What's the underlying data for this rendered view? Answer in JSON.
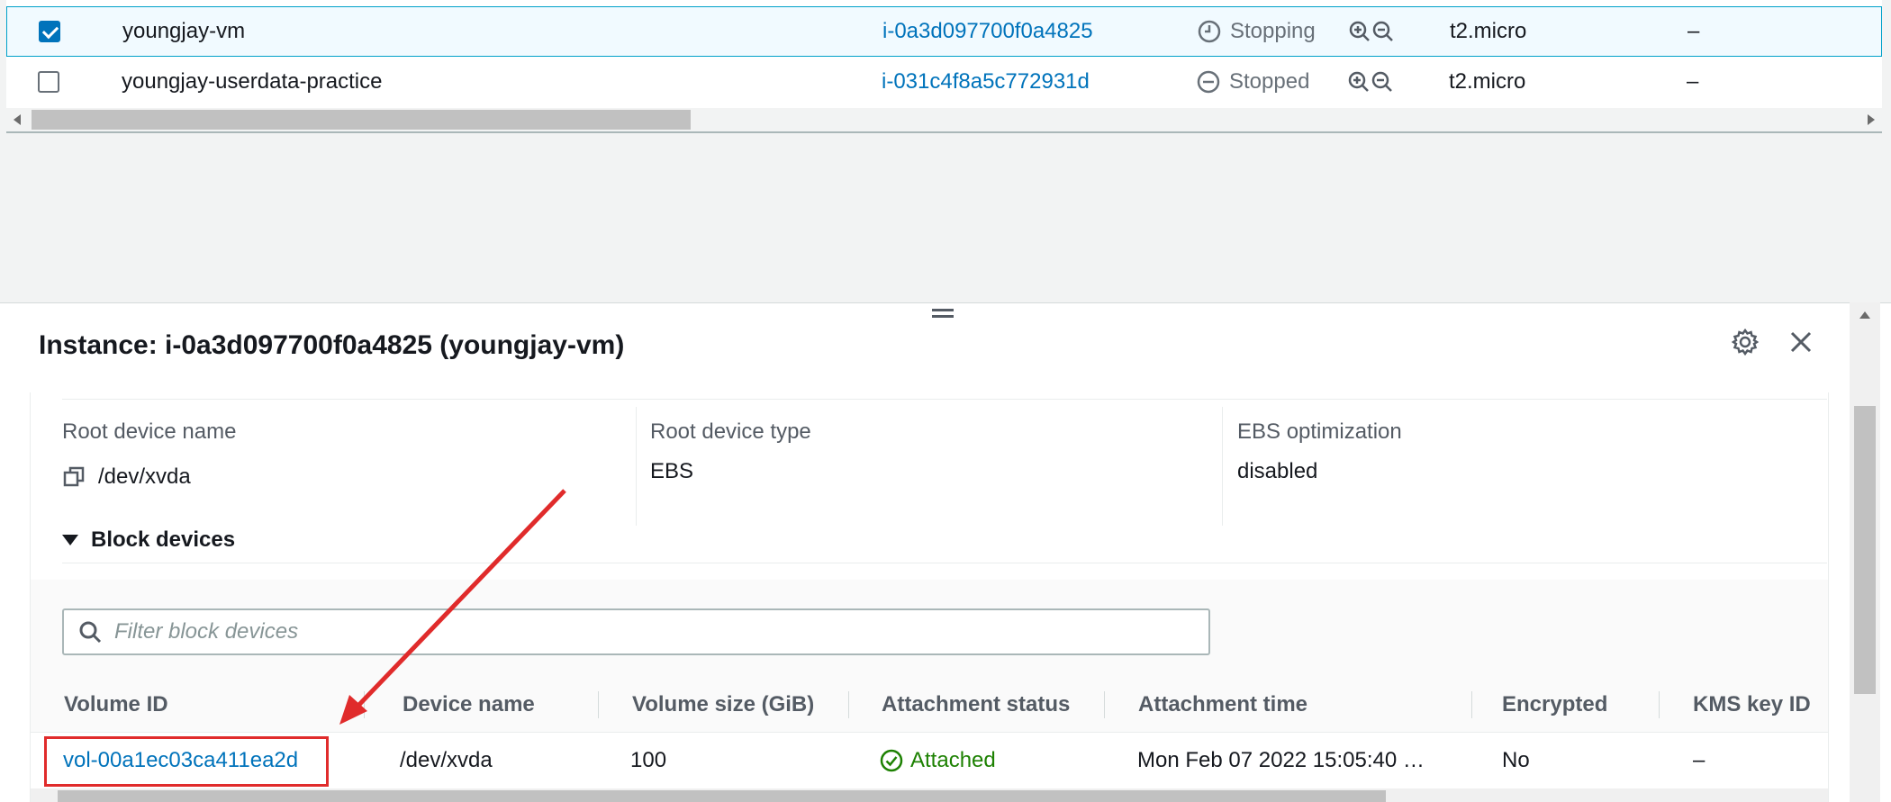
{
  "instances": [
    {
      "name": "youngjay-vm",
      "id": "i-0a3d097700f0a4825",
      "state": "Stopping",
      "state_icon": "clock-icon",
      "type": "t2.micro",
      "extra": "–",
      "selected": true
    },
    {
      "name": "youngjay-userdata-practice",
      "id": "i-031c4f8a5c772931d",
      "state": "Stopped",
      "state_icon": "minus-circle-icon",
      "type": "t2.micro",
      "extra": "–",
      "selected": false
    }
  ],
  "panel": {
    "title": "Instance: i-0a3d097700f0a4825 (youngjay-vm)"
  },
  "details": {
    "root_device_name_label": "Root device name",
    "root_device_name_value": "/dev/xvda",
    "root_device_type_label": "Root device type",
    "root_device_type_value": "EBS",
    "ebs_opt_label": "EBS optimization",
    "ebs_opt_value": "disabled"
  },
  "block_devices": {
    "heading": "Block devices",
    "filter_placeholder": "Filter block devices",
    "columns": [
      "Volume ID",
      "Device name",
      "Volume size (GiB)",
      "Attachment status",
      "Attachment time",
      "Encrypted",
      "KMS key ID"
    ],
    "rows": [
      {
        "volume_id": "vol-00a1ec03ca411ea2d",
        "device": "/dev/xvda",
        "size": "100",
        "status": "Attached",
        "time": "Mon Feb 07 2022 15:05:40 …",
        "encrypted": "No",
        "kms": "–"
      }
    ]
  },
  "colors": {
    "link": "#0073bb",
    "success": "#1d8102",
    "annotation": "#e02b2b",
    "selection_bg": "#f1faff"
  }
}
